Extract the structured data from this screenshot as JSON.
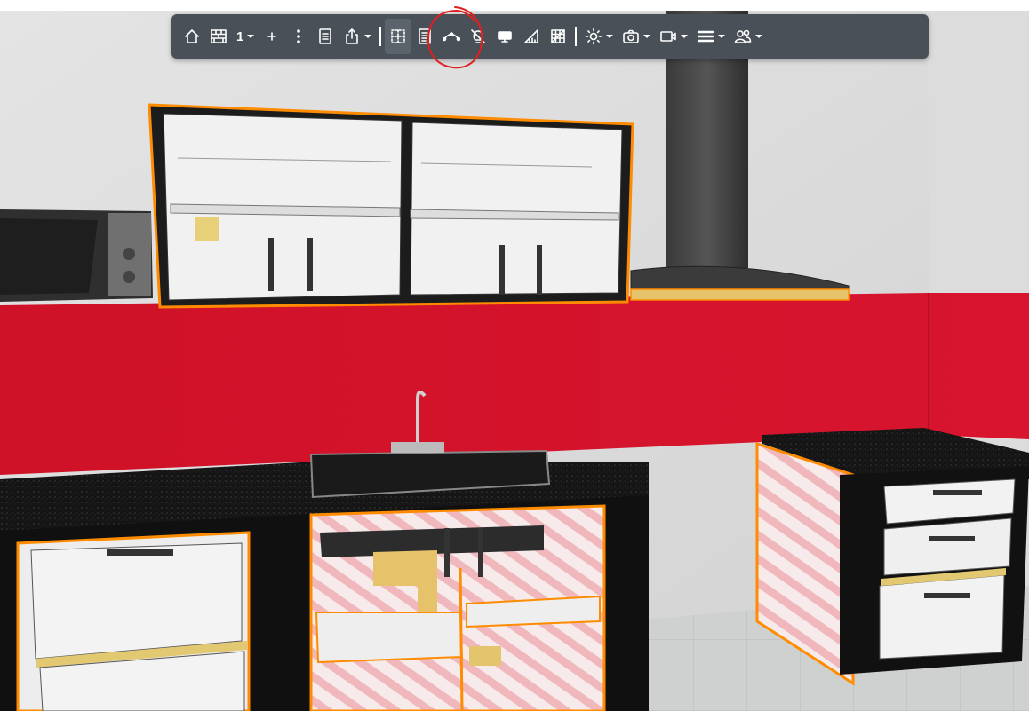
{
  "toolbar": {
    "level_label": "1",
    "items": [
      {
        "name": "home-icon"
      },
      {
        "name": "wall-icon"
      },
      {
        "name": "level-selector"
      },
      {
        "name": "add-icon"
      },
      {
        "name": "more-options-icon"
      },
      {
        "name": "document-icon"
      },
      {
        "name": "export-icon"
      },
      {
        "name": "selection-box-icon",
        "active": true
      },
      {
        "name": "notes-icon"
      },
      {
        "name": "path-icon"
      },
      {
        "name": "lightbulb-off-icon"
      },
      {
        "name": "display-icon"
      },
      {
        "name": "ruler-icon"
      },
      {
        "name": "grid-icon"
      },
      {
        "name": "brightness-icon"
      },
      {
        "name": "camera-icon"
      },
      {
        "name": "video-icon"
      },
      {
        "name": "menu-icon"
      },
      {
        "name": "users-icon"
      }
    ]
  },
  "colors": {
    "toolbar_bg": "#495057",
    "accent_orange": "#ff8c00",
    "backsplash_red": "#d0142c",
    "annotation_red": "#e02020"
  }
}
